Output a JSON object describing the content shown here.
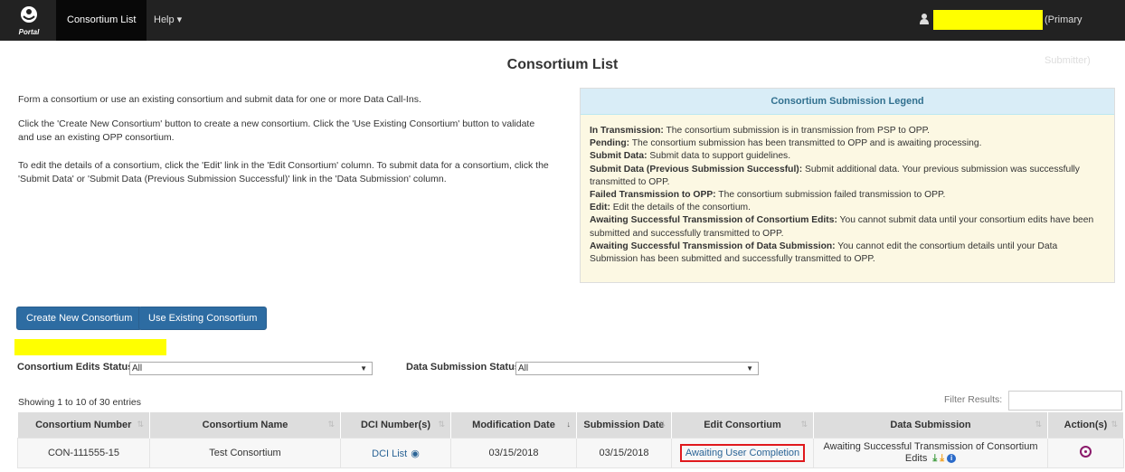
{
  "navbar": {
    "logo_text": "Portal",
    "items": [
      {
        "label": "Consortium List"
      },
      {
        "label": "Help ▾"
      }
    ],
    "user_role": "(Primary Submitter)",
    "highlight_color": "#ffff00"
  },
  "page": {
    "title": "Consortium List"
  },
  "intro": [
    "Form a consortium or use an existing consortium and submit data for one or more Data Call-Ins.",
    "Click the 'Create New Consortium' button to create a new consortium. Click the 'Use Existing Consortium' button to validate and use an existing OPP consortium.",
    "To edit the details of a consortium, click the 'Edit' link in the 'Edit Consortium' column. To submit data for a consortium, click the 'Submit Data' or 'Submit Data (Previous Submission Successful)' link in the 'Data Submission' column."
  ],
  "legend": {
    "title": "Consortium Submission Legend",
    "items": [
      {
        "term": "In Transmission:",
        "desc": " The consortium submission is in transmission from PSP to OPP."
      },
      {
        "term": "Pending:",
        "desc": " The consortium submission has been transmitted to OPP and is awaiting processing."
      },
      {
        "term": "Submit Data:",
        "desc": " Submit data to support guidelines."
      },
      {
        "term": "Submit Data (Previous Submission Successful):",
        "desc": " Submit additional data. Your previous submission was successfully transmitted to OPP."
      },
      {
        "term": "Failed Transmission to OPP:",
        "desc": " The consortium submission failed transmission to OPP."
      },
      {
        "term": "Edit:",
        "desc": " Edit the details of the consortium."
      },
      {
        "term": "Awaiting Successful Transmission of Consortium Edits:",
        "desc": " You cannot submit data until your consortium edits have been submitted and successfully transmitted to OPP."
      },
      {
        "term": "Awaiting Successful Transmission of Data Submission:",
        "desc": " You cannot edit the consortium details until your Data Submission has been submitted and successfully transmitted to OPP."
      }
    ]
  },
  "buttons": {
    "create": "Create New Consortium",
    "use_existing": "Use Existing Consortium"
  },
  "filters": {
    "edits_label": "Consortium Edits Status",
    "edits_value": "All",
    "submission_label": "Data Submission Status",
    "submission_value": "All"
  },
  "table_info": {
    "showing": "Showing 1 to 10 of 30 entries",
    "filter_label": "Filter Results:"
  },
  "table": {
    "headers": [
      "Consortium Number",
      "Consortium Name",
      "DCI Number(s)",
      "Modification Date",
      "Submission Date",
      "Edit Consortium",
      "Data Submission",
      "Action(s)"
    ],
    "rows": [
      {
        "number": "CON-111555-15",
        "name": "Test Consortium",
        "dci": "DCI List",
        "modified": "03/15/2018",
        "submitted": "03/15/2018",
        "edit": "Awaiting User Completion",
        "submission": "Awaiting Successful Transmission of Consortium Edits"
      }
    ]
  },
  "colors": {
    "navbar": "#222222",
    "button": "#2d6ca2",
    "legend_header": "#d9edf7",
    "legend_body": "#fcf8e3",
    "highlight_box": "#e0191d"
  }
}
